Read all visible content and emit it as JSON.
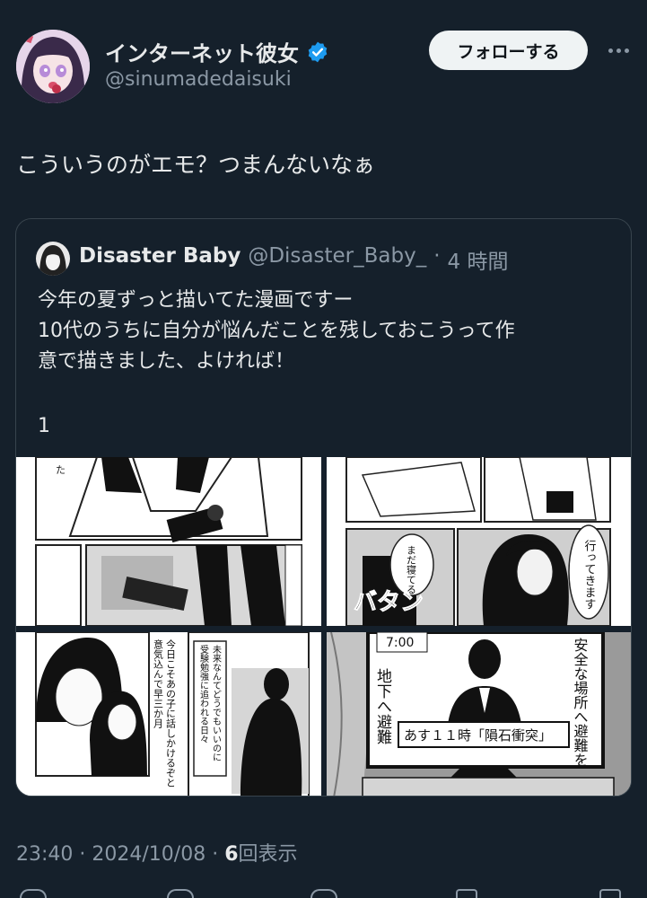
{
  "author": {
    "display_name": "インターネット彼女",
    "handle": "@sinumadedaisuki",
    "verified": true
  },
  "follow_label": "フォローする",
  "tweet_text": "こういうのがエモ？つまんないなぁ",
  "quoted": {
    "name": "Disaster Baby",
    "handle": "@Disaster_Baby_",
    "separator": "·",
    "time": "4 時間",
    "text_lines": [
      "今年の夏ずっと描いてた漫画ですー",
      "10代のうちに自分が悩んだことを残しておこうって作",
      "意で描きました、よければ！"
    ],
    "index": "1",
    "panel_texts": {
      "p2_bubble1": "まだ寝てるか…",
      "p2_bubble2": "行ってきます",
      "p2_sfx": "バタン",
      "p3_caption1": "今日こそあの子に話しかけるぞと",
      "p3_caption2": "意気込んで早三か月",
      "p3_caption3": "未来なんてどうでもいいのに",
      "p3_caption4": "受験勉強に追われる日々",
      "p4_banner": "あす１１時「隕石衝突」",
      "p4_left": "地下へ避難",
      "p4_right": "安全な場所へ避難を",
      "p4_time": "7:00"
    }
  },
  "meta": {
    "time": "23:40",
    "date": "2024/10/08",
    "separator": "·",
    "views_count": "6",
    "views_label": "回表示"
  },
  "colors": {
    "background": "#15202b",
    "text": "#e7e9ea",
    "muted": "#8b98a5",
    "verified": "#1d9bf0",
    "border": "#38444d"
  }
}
